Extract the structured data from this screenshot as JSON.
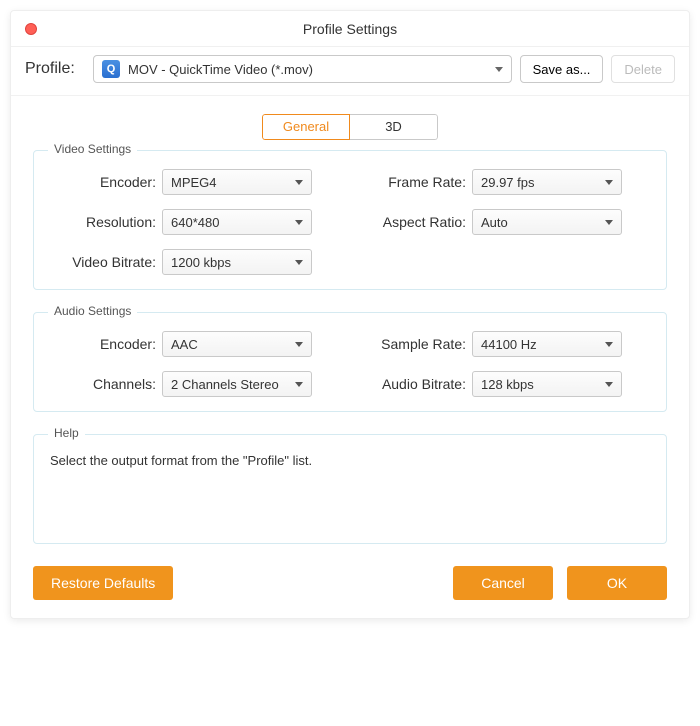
{
  "title": "Profile Settings",
  "profile": {
    "label": "Profile:",
    "selected": "MOV - QuickTime Video (*.mov)",
    "save_as": "Save as...",
    "delete": "Delete"
  },
  "tabs": {
    "general": "General",
    "three_d": "3D"
  },
  "video": {
    "legend": "Video Settings",
    "encoder_label": "Encoder:",
    "encoder_value": "MPEG4",
    "resolution_label": "Resolution:",
    "resolution_value": "640*480",
    "bitrate_label": "Video Bitrate:",
    "bitrate_value": "1200 kbps",
    "framerate_label": "Frame Rate:",
    "framerate_value": "29.97 fps",
    "aspect_label": "Aspect Ratio:",
    "aspect_value": "Auto"
  },
  "audio": {
    "legend": "Audio Settings",
    "encoder_label": "Encoder:",
    "encoder_value": "AAC",
    "channels_label": "Channels:",
    "channels_value": "2 Channels Stereo",
    "samplerate_label": "Sample Rate:",
    "samplerate_value": "44100 Hz",
    "bitrate_label": "Audio Bitrate:",
    "bitrate_value": "128 kbps"
  },
  "help": {
    "legend": "Help",
    "text": "Select the output format from the \"Profile\" list."
  },
  "footer": {
    "restore": "Restore Defaults",
    "cancel": "Cancel",
    "ok": "OK"
  }
}
